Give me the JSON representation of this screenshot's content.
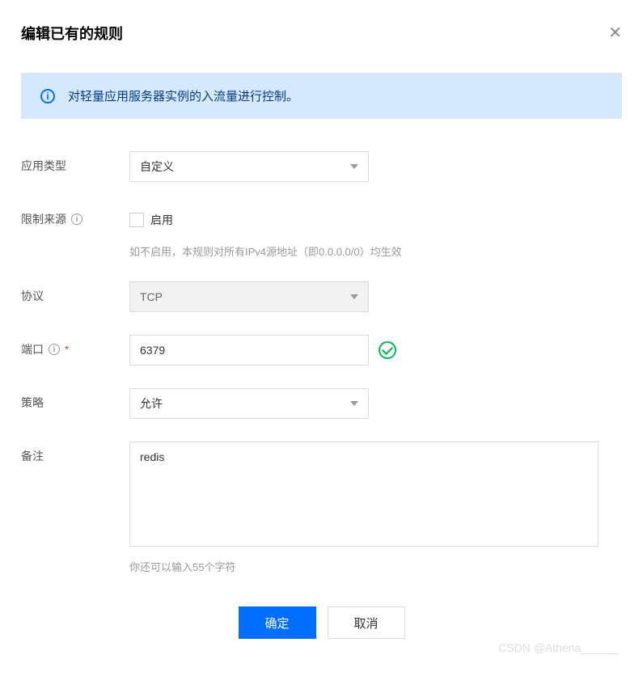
{
  "header": {
    "title": "编辑已有的规则"
  },
  "alert": {
    "text": "对轻量应用服务器实例的入流量进行控制。"
  },
  "form": {
    "app_type": {
      "label": "应用类型",
      "value": "自定义"
    },
    "restrict_source": {
      "label": "限制来源",
      "checkbox_label": "启用",
      "help": "如不启用，本规则对所有IPv4源地址（即0.0.0.0/0）均生效"
    },
    "protocol": {
      "label": "协议",
      "value": "TCP"
    },
    "port": {
      "label": "端口",
      "value": "6379"
    },
    "policy": {
      "label": "策略",
      "value": "允许"
    },
    "remark": {
      "label": "备注",
      "value": "redis",
      "help": "你还可以输入55个字符"
    }
  },
  "footer": {
    "ok": "确定",
    "cancel": "取消"
  },
  "watermark": "CSDN @Athena______"
}
